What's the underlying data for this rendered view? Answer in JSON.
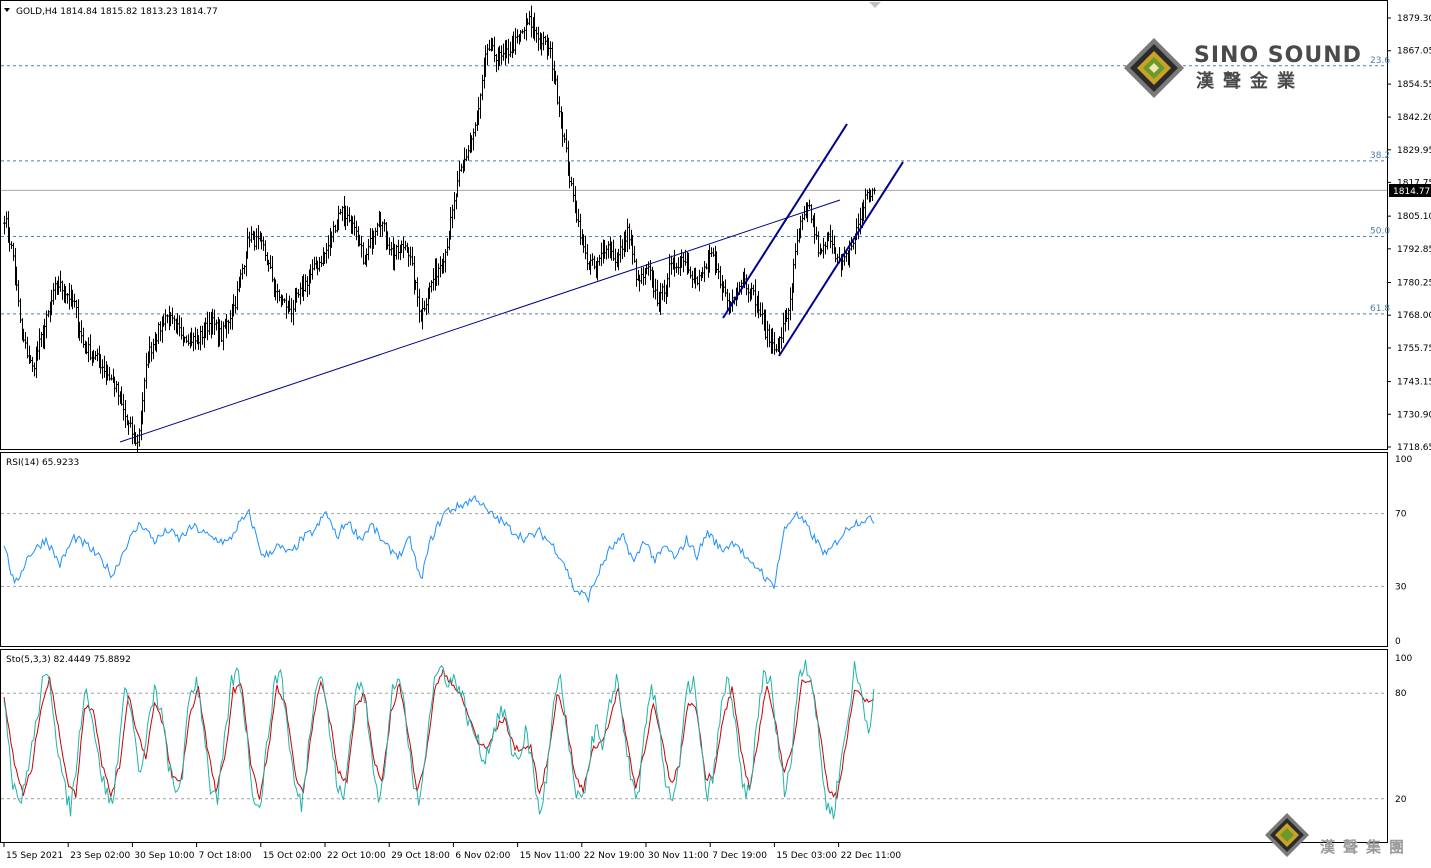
{
  "header": {
    "symbol_line": "GOLD,H4  1814.84 1815.82 1813.23 1814.77",
    "current_price": "1814.77"
  },
  "branding": {
    "title": "SINO SOUND",
    "subtitle": "漢聲金業",
    "footer": "漢聲集團"
  },
  "colors": {
    "candle": "#000000",
    "trendline": "#00008b",
    "fib": "#4a7fb5",
    "price_line": "#a8a8a8",
    "rsi": "#1e90ff",
    "stoch_main": "#20b2aa",
    "stoch_signal": "#cc0000",
    "level": "#a0a0a0"
  },
  "price_axis": {
    "ticks": [
      "1879.30",
      "1867.05",
      "1854.55",
      "1842.20",
      "1829.95",
      "1817.75",
      "1805.10",
      "1792.85",
      "1780.25",
      "1768.00",
      "1755.75",
      "1743.15",
      "1730.90",
      "1718.65"
    ]
  },
  "fib_levels": [
    {
      "label": "23.6",
      "price": 1861.4
    },
    {
      "label": "38.2",
      "price": 1825.8
    },
    {
      "label": "50.0",
      "price": 1797.5
    },
    {
      "label": "61.8",
      "price": 1768.5
    }
  ],
  "time_axis": {
    "labels": [
      "15 Sep 2021",
      "23 Sep 02:00",
      "30 Sep 10:00",
      "7 Oct 18:00",
      "15 Oct 02:00",
      "22 Oct 10:00",
      "29 Oct 18:00",
      "6 Nov 02:00",
      "15 Nov 11:00",
      "22 Nov 19:00",
      "30 Nov 11:00",
      "7 Dec 19:00",
      "15 Dec 03:00",
      "22 Dec 11:00"
    ]
  },
  "rsi": {
    "label": "RSI(14) 65.9233",
    "ticks": [
      "100",
      "70",
      "30",
      "0"
    ]
  },
  "stochastic": {
    "label": "Sto(5,3,3) 82.4449 75.8892",
    "ticks": [
      "100",
      "80",
      "20"
    ]
  },
  "chart_data": {
    "type": "ohlc",
    "symbol": "GOLD",
    "timeframe": "H4",
    "last": {
      "open": 1814.84,
      "high": 1815.82,
      "low": 1813.23,
      "close": 1814.77
    },
    "ylim": [
      1714,
      1882
    ],
    "anchors": [
      [
        0,
        1805
      ],
      [
        5,
        1790
      ],
      [
        10,
        1760
      ],
      [
        16,
        1748
      ],
      [
        24,
        1766
      ],
      [
        30,
        1780
      ],
      [
        36,
        1776
      ],
      [
        40,
        1772
      ],
      [
        45,
        1757
      ],
      [
        55,
        1750
      ],
      [
        63,
        1742
      ],
      [
        70,
        1728
      ],
      [
        76,
        1720
      ],
      [
        82,
        1753
      ],
      [
        92,
        1768
      ],
      [
        100,
        1762
      ],
      [
        110,
        1758
      ],
      [
        118,
        1766
      ],
      [
        124,
        1760
      ],
      [
        132,
        1773
      ],
      [
        140,
        1798
      ],
      [
        148,
        1793
      ],
      [
        156,
        1775
      ],
      [
        164,
        1770
      ],
      [
        172,
        1780
      ],
      [
        184,
        1792
      ],
      [
        192,
        1808
      ],
      [
        198,
        1803
      ],
      [
        206,
        1788
      ],
      [
        214,
        1806
      ],
      [
        222,
        1790
      ],
      [
        230,
        1795
      ],
      [
        238,
        1768
      ],
      [
        244,
        1780
      ],
      [
        252,
        1792
      ],
      [
        260,
        1820
      ],
      [
        270,
        1840
      ],
      [
        276,
        1868
      ],
      [
        284,
        1864
      ],
      [
        292,
        1870
      ],
      [
        300,
        1878
      ],
      [
        312,
        1866
      ],
      [
        318,
        1842
      ],
      [
        324,
        1815
      ],
      [
        332,
        1790
      ],
      [
        338,
        1785
      ],
      [
        344,
        1795
      ],
      [
        350,
        1788
      ],
      [
        356,
        1800
      ],
      [
        362,
        1780
      ],
      [
        368,
        1785
      ],
      [
        374,
        1772
      ],
      [
        380,
        1785
      ],
      [
        388,
        1790
      ],
      [
        396,
        1780
      ],
      [
        404,
        1790
      ],
      [
        414,
        1772
      ],
      [
        422,
        1782
      ],
      [
        430,
        1773
      ],
      [
        436,
        1760
      ],
      [
        442,
        1756
      ],
      [
        448,
        1770
      ],
      [
        454,
        1800
      ],
      [
        460,
        1808
      ],
      [
        466,
        1790
      ],
      [
        472,
        1798
      ],
      [
        478,
        1785
      ],
      [
        486,
        1797
      ],
      [
        492,
        1812
      ],
      [
        497,
        1814.77
      ]
    ],
    "rsi_anchors": [
      [
        0,
        54
      ],
      [
        6,
        30
      ],
      [
        14,
        47
      ],
      [
        24,
        56
      ],
      [
        32,
        42
      ],
      [
        40,
        57
      ],
      [
        48,
        52
      ],
      [
        56,
        44
      ],
      [
        62,
        36
      ],
      [
        70,
        53
      ],
      [
        78,
        65
      ],
      [
        86,
        55
      ],
      [
        94,
        61
      ],
      [
        100,
        56
      ],
      [
        108,
        63
      ],
      [
        118,
        57
      ],
      [
        128,
        54
      ],
      [
        134,
        64
      ],
      [
        140,
        70
      ],
      [
        148,
        46
      ],
      [
        156,
        52
      ],
      [
        164,
        48
      ],
      [
        170,
        56
      ],
      [
        178,
        61
      ],
      [
        184,
        71
      ],
      [
        190,
        57
      ],
      [
        196,
        66
      ],
      [
        204,
        56
      ],
      [
        210,
        64
      ],
      [
        218,
        52
      ],
      [
        226,
        47
      ],
      [
        232,
        56
      ],
      [
        238,
        33
      ],
      [
        244,
        56
      ],
      [
        252,
        71
      ],
      [
        260,
        74
      ],
      [
        270,
        79
      ],
      [
        276,
        71
      ],
      [
        284,
        66
      ],
      [
        290,
        61
      ],
      [
        298,
        56
      ],
      [
        306,
        60
      ],
      [
        314,
        52
      ],
      [
        320,
        43
      ],
      [
        326,
        28
      ],
      [
        334,
        24
      ],
      [
        340,
        38
      ],
      [
        346,
        50
      ],
      [
        354,
        57
      ],
      [
        360,
        43
      ],
      [
        366,
        56
      ],
      [
        372,
        44
      ],
      [
        378,
        52
      ],
      [
        384,
        45
      ],
      [
        390,
        56
      ],
      [
        396,
        47
      ],
      [
        402,
        60
      ],
      [
        410,
        50
      ],
      [
        418,
        55
      ],
      [
        426,
        42
      ],
      [
        432,
        40
      ],
      [
        436,
        33
      ],
      [
        440,
        31
      ],
      [
        446,
        61
      ],
      [
        452,
        70
      ],
      [
        458,
        64
      ],
      [
        464,
        55
      ],
      [
        470,
        47
      ],
      [
        476,
        55
      ],
      [
        484,
        64
      ],
      [
        492,
        67
      ],
      [
        497,
        66
      ]
    ],
    "stoch_anchors": [
      [
        0,
        80
      ],
      [
        5,
        30
      ],
      [
        10,
        18
      ],
      [
        14,
        40
      ],
      [
        18,
        60
      ],
      [
        22,
        85
      ],
      [
        26,
        90
      ],
      [
        30,
        55
      ],
      [
        34,
        28
      ],
      [
        38,
        14
      ],
      [
        42,
        45
      ],
      [
        46,
        84
      ],
      [
        50,
        70
      ],
      [
        54,
        42
      ],
      [
        58,
        25
      ],
      [
        62,
        16
      ],
      [
        66,
        55
      ],
      [
        70,
        86
      ],
      [
        74,
        60
      ],
      [
        78,
        32
      ],
      [
        82,
        58
      ],
      [
        86,
        82
      ],
      [
        90,
        68
      ],
      [
        94,
        40
      ],
      [
        98,
        22
      ],
      [
        102,
        35
      ],
      [
        106,
        78
      ],
      [
        110,
        88
      ],
      [
        114,
        62
      ],
      [
        118,
        26
      ],
      [
        122,
        18
      ],
      [
        126,
        52
      ],
      [
        130,
        86
      ],
      [
        134,
        93
      ],
      [
        138,
        63
      ],
      [
        142,
        25
      ],
      [
        146,
        13
      ],
      [
        150,
        48
      ],
      [
        154,
        82
      ],
      [
        158,
        95
      ],
      [
        162,
        60
      ],
      [
        166,
        28
      ],
      [
        170,
        16
      ],
      [
        174,
        50
      ],
      [
        178,
        86
      ],
      [
        182,
        90
      ],
      [
        186,
        58
      ],
      [
        190,
        30
      ],
      [
        194,
        18
      ],
      [
        198,
        56
      ],
      [
        202,
        88
      ],
      [
        206,
        78
      ],
      [
        210,
        45
      ],
      [
        214,
        22
      ],
      [
        218,
        40
      ],
      [
        222,
        82
      ],
      [
        226,
        90
      ],
      [
        230,
        60
      ],
      [
        234,
        28
      ],
      [
        238,
        18
      ],
      [
        242,
        60
      ],
      [
        246,
        88
      ],
      [
        250,
        95
      ],
      [
        254,
        86
      ],
      [
        258,
        88
      ],
      [
        262,
        78
      ],
      [
        266,
        62
      ],
      [
        270,
        55
      ],
      [
        274,
        42
      ],
      [
        278,
        52
      ],
      [
        282,
        66
      ],
      [
        286,
        70
      ],
      [
        290,
        48
      ],
      [
        294,
        42
      ],
      [
        298,
        58
      ],
      [
        302,
        40
      ],
      [
        306,
        10
      ],
      [
        310,
        32
      ],
      [
        314,
        72
      ],
      [
        318,
        88
      ],
      [
        322,
        55
      ],
      [
        326,
        26
      ],
      [
        330,
        16
      ],
      [
        334,
        40
      ],
      [
        338,
        62
      ],
      [
        342,
        46
      ],
      [
        346,
        72
      ],
      [
        350,
        90
      ],
      [
        354,
        62
      ],
      [
        358,
        32
      ],
      [
        362,
        20
      ],
      [
        366,
        55
      ],
      [
        370,
        82
      ],
      [
        374,
        66
      ],
      [
        378,
        30
      ],
      [
        382,
        20
      ],
      [
        386,
        38
      ],
      [
        390,
        80
      ],
      [
        394,
        88
      ],
      [
        398,
        50
      ],
      [
        402,
        20
      ],
      [
        406,
        38
      ],
      [
        410,
        72
      ],
      [
        414,
        90
      ],
      [
        418,
        60
      ],
      [
        422,
        26
      ],
      [
        426,
        22
      ],
      [
        430,
        60
      ],
      [
        434,
        92
      ],
      [
        438,
        86
      ],
      [
        442,
        52
      ],
      [
        446,
        26
      ],
      [
        450,
        42
      ],
      [
        454,
        90
      ],
      [
        458,
        98
      ],
      [
        462,
        86
      ],
      [
        466,
        50
      ],
      [
        470,
        16
      ],
      [
        474,
        12
      ],
      [
        478,
        40
      ],
      [
        482,
        64
      ],
      [
        486,
        94
      ],
      [
        490,
        80
      ],
      [
        494,
        58
      ],
      [
        497,
        82
      ]
    ],
    "stoch_signal_anchors": [
      [
        0,
        76
      ],
      [
        6,
        40
      ],
      [
        11,
        22
      ],
      [
        16,
        38
      ],
      [
        21,
        72
      ],
      [
        26,
        88
      ],
      [
        31,
        62
      ],
      [
        36,
        30
      ],
      [
        41,
        22
      ],
      [
        46,
        72
      ],
      [
        51,
        72
      ],
      [
        56,
        40
      ],
      [
        61,
        22
      ],
      [
        66,
        38
      ],
      [
        71,
        80
      ],
      [
        76,
        58
      ],
      [
        81,
        44
      ],
      [
        86,
        74
      ],
      [
        91,
        62
      ],
      [
        96,
        32
      ],
      [
        101,
        30
      ],
      [
        106,
        66
      ],
      [
        111,
        84
      ],
      [
        116,
        50
      ],
      [
        121,
        24
      ],
      [
        126,
        42
      ],
      [
        131,
        82
      ],
      [
        136,
        84
      ],
      [
        141,
        40
      ],
      [
        146,
        20
      ],
      [
        151,
        48
      ],
      [
        156,
        84
      ],
      [
        161,
        72
      ],
      [
        166,
        36
      ],
      [
        171,
        22
      ],
      [
        176,
        60
      ],
      [
        181,
        88
      ],
      [
        186,
        66
      ],
      [
        191,
        36
      ],
      [
        196,
        30
      ],
      [
        201,
        72
      ],
      [
        206,
        80
      ],
      [
        211,
        44
      ],
      [
        216,
        28
      ],
      [
        221,
        68
      ],
      [
        226,
        86
      ],
      [
        231,
        56
      ],
      [
        236,
        26
      ],
      [
        241,
        42
      ],
      [
        246,
        82
      ],
      [
        251,
        92
      ],
      [
        256,
        86
      ],
      [
        261,
        78
      ],
      [
        266,
        66
      ],
      [
        271,
        52
      ],
      [
        276,
        48
      ],
      [
        281,
        60
      ],
      [
        286,
        66
      ],
      [
        291,
        50
      ],
      [
        296,
        48
      ],
      [
        301,
        50
      ],
      [
        306,
        22
      ],
      [
        311,
        44
      ],
      [
        316,
        80
      ],
      [
        321,
        66
      ],
      [
        326,
        34
      ],
      [
        331,
        24
      ],
      [
        336,
        48
      ],
      [
        341,
        52
      ],
      [
        346,
        64
      ],
      [
        351,
        82
      ],
      [
        356,
        52
      ],
      [
        361,
        26
      ],
      [
        366,
        48
      ],
      [
        371,
        74
      ],
      [
        376,
        52
      ],
      [
        381,
        28
      ],
      [
        386,
        40
      ],
      [
        391,
        76
      ],
      [
        396,
        70
      ],
      [
        401,
        32
      ],
      [
        406,
        34
      ],
      [
        411,
        66
      ],
      [
        416,
        82
      ],
      [
        421,
        48
      ],
      [
        426,
        26
      ],
      [
        431,
        54
      ],
      [
        436,
        86
      ],
      [
        441,
        62
      ],
      [
        446,
        34
      ],
      [
        451,
        50
      ],
      [
        456,
        88
      ],
      [
        461,
        88
      ],
      [
        466,
        60
      ],
      [
        471,
        24
      ],
      [
        476,
        22
      ],
      [
        481,
        50
      ],
      [
        486,
        82
      ],
      [
        491,
        76
      ],
      [
        497,
        76
      ]
    ]
  }
}
